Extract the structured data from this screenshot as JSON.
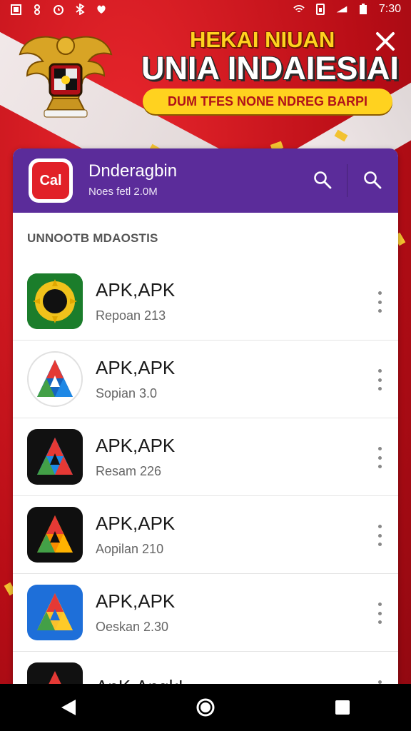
{
  "status_bar": {
    "time": "7:30",
    "icons_left": [
      "image-icon",
      "settings-icon",
      "alarm-icon",
      "bluetooth-icon",
      "shield-icon"
    ],
    "icons_right": [
      "wifi-icon",
      "sim-icon",
      "signal-icon",
      "battery-icon"
    ]
  },
  "promo": {
    "title_line_1": "HEKAI NIUAN",
    "title_line_2": "UNIA INDAIESIAI",
    "pill_text": "DUM TFES NONE NDREG BARPI",
    "emblem": "garuda-emblem",
    "colors": {
      "red": "#c8141c",
      "gold": "#ffd21f"
    }
  },
  "app_header": {
    "icon_text": "Cal",
    "name": "Dnderagbin",
    "subtitle": "Noes fetl 2.0M",
    "accent": "#5b2c9a"
  },
  "section_title": "UNNOOTB MDAOSTIS",
  "items": [
    {
      "title": "APK,APK",
      "subtitle": "Repoan 213",
      "icon": "sunflower-icon"
    },
    {
      "title": "APK,APK",
      "subtitle": "Sopian 3.0",
      "icon": "a-logo-icon"
    },
    {
      "title": "APK,APK",
      "subtitle": "Resam 226",
      "icon": "a-logo-icon"
    },
    {
      "title": "APK,APK",
      "subtitle": "Aopilan 210",
      "icon": "a-logo-icon"
    },
    {
      "title": "APK,APK",
      "subtitle": "Oeskan 2.30",
      "icon": "a-logo-icon"
    },
    {
      "title": "ApK,Apgk!",
      "subtitle": "",
      "icon": "a-logo-icon"
    }
  ],
  "nav": [
    "back-icon",
    "home-icon",
    "recents-icon"
  ]
}
